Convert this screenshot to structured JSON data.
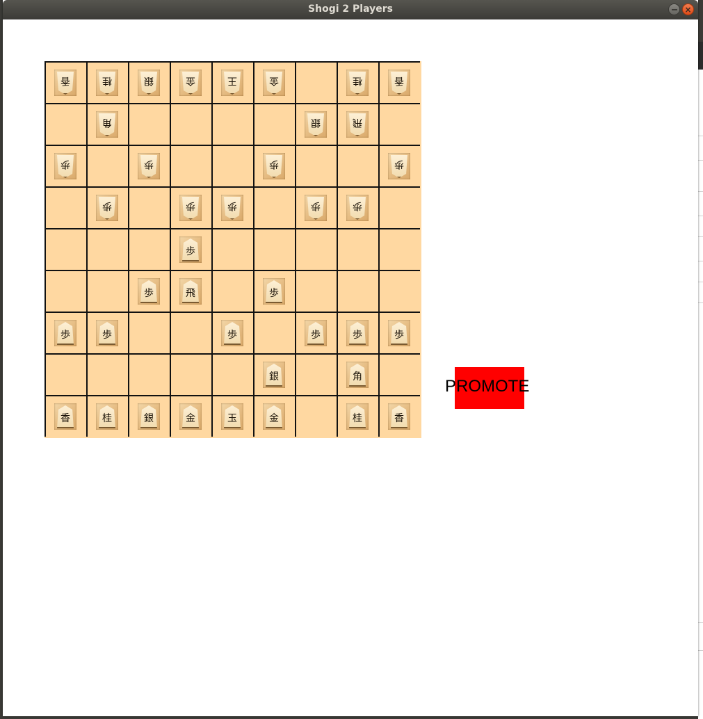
{
  "window": {
    "title": "Shogi 2 Players",
    "close_symbol": "×"
  },
  "colors": {
    "board": "#ffd8a1",
    "grid": "#111111",
    "promote_bg": "#ff0000"
  },
  "promote": {
    "label": "PROMOTE"
  },
  "board": {
    "rows": 9,
    "cols": 9,
    "squares": [
      [
        {
          "k": "香",
          "side": "gote"
        },
        {
          "k": "桂",
          "side": "gote"
        },
        {
          "k": "銀",
          "side": "gote"
        },
        {
          "k": "金",
          "side": "gote"
        },
        {
          "k": "王",
          "side": "gote"
        },
        {
          "k": "金",
          "side": "gote"
        },
        null,
        {
          "k": "桂",
          "side": "gote"
        },
        {
          "k": "香",
          "side": "gote"
        }
      ],
      [
        null,
        {
          "k": "角",
          "side": "gote"
        },
        null,
        null,
        null,
        null,
        {
          "k": "銀",
          "side": "gote"
        },
        {
          "k": "飛",
          "side": "gote"
        },
        null
      ],
      [
        {
          "k": "歩",
          "side": "gote"
        },
        null,
        {
          "k": "歩",
          "side": "gote"
        },
        null,
        null,
        {
          "k": "歩",
          "side": "gote"
        },
        null,
        null,
        {
          "k": "歩",
          "side": "gote"
        }
      ],
      [
        null,
        {
          "k": "歩",
          "side": "gote"
        },
        null,
        {
          "k": "歩",
          "side": "gote"
        },
        {
          "k": "歩",
          "side": "gote"
        },
        null,
        {
          "k": "歩",
          "side": "gote"
        },
        {
          "k": "歩",
          "side": "gote"
        },
        null
      ],
      [
        null,
        null,
        null,
        {
          "k": "歩",
          "side": "sente"
        },
        null,
        null,
        null,
        null,
        null
      ],
      [
        null,
        null,
        {
          "k": "歩",
          "side": "sente"
        },
        {
          "k": "飛",
          "side": "sente"
        },
        null,
        {
          "k": "歩",
          "side": "sente"
        },
        null,
        null,
        null
      ],
      [
        {
          "k": "歩",
          "side": "sente"
        },
        {
          "k": "歩",
          "side": "sente"
        },
        null,
        null,
        {
          "k": "歩",
          "side": "sente"
        },
        null,
        {
          "k": "歩",
          "side": "sente"
        },
        {
          "k": "歩",
          "side": "sente"
        },
        {
          "k": "歩",
          "side": "sente"
        }
      ],
      [
        null,
        null,
        null,
        null,
        null,
        {
          "k": "銀",
          "side": "sente"
        },
        null,
        {
          "k": "角",
          "side": "sente"
        },
        null
      ],
      [
        {
          "k": "香",
          "side": "sente"
        },
        {
          "k": "桂",
          "side": "sente"
        },
        {
          "k": "銀",
          "side": "sente"
        },
        {
          "k": "金",
          "side": "sente"
        },
        {
          "k": "玉",
          "side": "sente"
        },
        {
          "k": "金",
          "side": "sente"
        },
        null,
        {
          "k": "桂",
          "side": "sente"
        },
        {
          "k": "香",
          "side": "sente"
        }
      ]
    ]
  }
}
